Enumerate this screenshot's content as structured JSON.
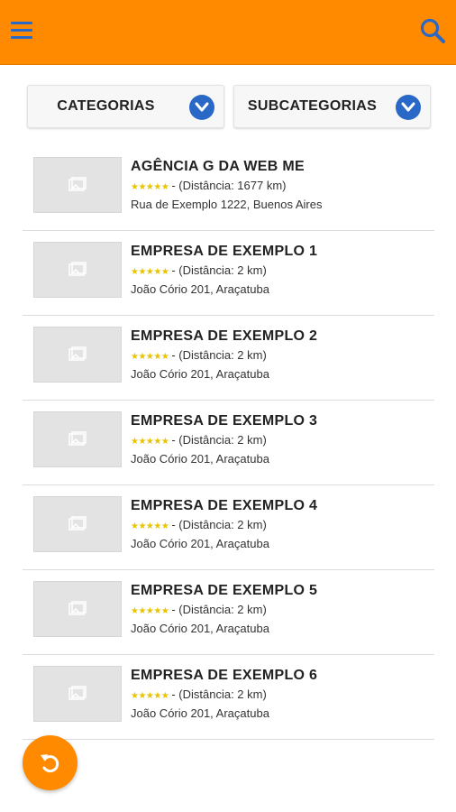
{
  "header": {
    "menu_icon": "hamburger-menu-icon",
    "search_icon": "search-icon",
    "background_color": "#ff8a00",
    "icon_color": "#2a68c8"
  },
  "filters": {
    "categories_label": "CATEGORIAS",
    "subcategories_label": "SUBCATEGORIAS",
    "dropdown_icon": "chevron-down-icon"
  },
  "listings": [
    {
      "name": "AGÊNCIA G DA WEB ME",
      "rating_stars": 5,
      "distance": "- (Distância: 1677 km)",
      "address": "Rua de Exemplo 1222, Buenos Aires"
    },
    {
      "name": "EMPRESA DE EXEMPLO 1",
      "rating_stars": 5,
      "distance": "- (Distância: 2 km)",
      "address": "João Cório 201, Araçatuba"
    },
    {
      "name": "EMPRESA DE EXEMPLO 2",
      "rating_stars": 5,
      "distance": "- (Distância: 2 km)",
      "address": "João Cório 201, Araçatuba"
    },
    {
      "name": "EMPRESA DE EXEMPLO 3",
      "rating_stars": 5,
      "distance": "- (Distância: 2 km)",
      "address": "João Cório 201, Araçatuba"
    },
    {
      "name": "EMPRESA DE EXEMPLO 4",
      "rating_stars": 5,
      "distance": "- (Distância: 2 km)",
      "address": "João Cório 201, Araçatuba"
    },
    {
      "name": "EMPRESA DE EXEMPLO 5",
      "rating_stars": 5,
      "distance": "- (Distância: 2 km)",
      "address": "João Cório 201, Araçatuba"
    },
    {
      "name": "EMPRESA DE EXEMPLO 6",
      "rating_stars": 5,
      "distance": "- (Distância: 2 km)",
      "address": "João Cório 201, Araçatuba"
    }
  ],
  "fab": {
    "icon": "undo-icon",
    "color": "#ff8a00"
  }
}
